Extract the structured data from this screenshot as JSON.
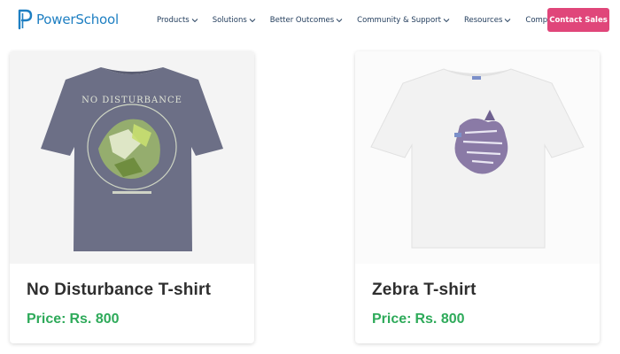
{
  "header": {
    "logo_text": "PowerSchool",
    "nav": [
      {
        "label": "Products"
      },
      {
        "label": "Solutions"
      },
      {
        "label": "Better Outcomes"
      },
      {
        "label": "Community & Support"
      },
      {
        "label": "Resources"
      },
      {
        "label": "Company"
      }
    ],
    "cta_label": "Contact Sales",
    "colors": {
      "brand": "#1e7fc2",
      "cta": "#e0467a"
    }
  },
  "products": [
    {
      "title": "No Disturbance T-shirt",
      "price_label": "Price:",
      "price_value": "Rs. 800",
      "image_icon": "grey-graphic-tshirt-image"
    },
    {
      "title": "Zebra T-shirt",
      "price_label": "Price:",
      "price_value": "Rs. 800",
      "image_icon": "white-zebra-tshirt-image"
    }
  ],
  "colors": {
    "price": "#2eaa5a",
    "title": "#2e2e2e"
  }
}
